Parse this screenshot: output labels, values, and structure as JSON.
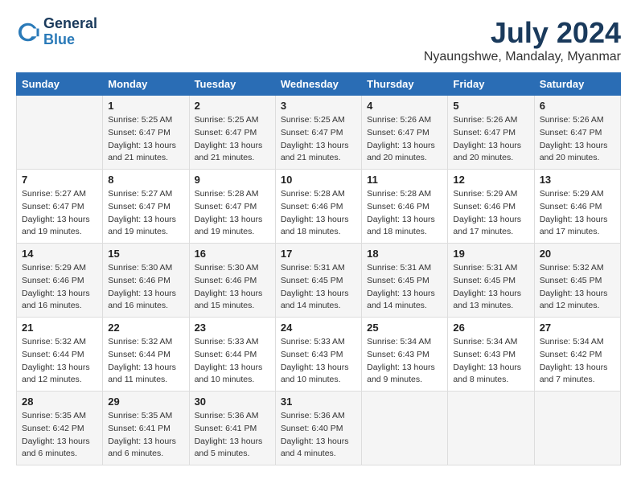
{
  "logo": {
    "line1": "General",
    "line2": "Blue"
  },
  "title": "July 2024",
  "subtitle": "Nyaungshwe, Mandalay, Myanmar",
  "headers": [
    "Sunday",
    "Monday",
    "Tuesday",
    "Wednesday",
    "Thursday",
    "Friday",
    "Saturday"
  ],
  "weeks": [
    [
      {
        "day": "",
        "info": ""
      },
      {
        "day": "1",
        "info": "Sunrise: 5:25 AM\nSunset: 6:47 PM\nDaylight: 13 hours\nand 21 minutes."
      },
      {
        "day": "2",
        "info": "Sunrise: 5:25 AM\nSunset: 6:47 PM\nDaylight: 13 hours\nand 21 minutes."
      },
      {
        "day": "3",
        "info": "Sunrise: 5:25 AM\nSunset: 6:47 PM\nDaylight: 13 hours\nand 21 minutes."
      },
      {
        "day": "4",
        "info": "Sunrise: 5:26 AM\nSunset: 6:47 PM\nDaylight: 13 hours\nand 20 minutes."
      },
      {
        "day": "5",
        "info": "Sunrise: 5:26 AM\nSunset: 6:47 PM\nDaylight: 13 hours\nand 20 minutes."
      },
      {
        "day": "6",
        "info": "Sunrise: 5:26 AM\nSunset: 6:47 PM\nDaylight: 13 hours\nand 20 minutes."
      }
    ],
    [
      {
        "day": "7",
        "info": "Sunrise: 5:27 AM\nSunset: 6:47 PM\nDaylight: 13 hours\nand 19 minutes."
      },
      {
        "day": "8",
        "info": "Sunrise: 5:27 AM\nSunset: 6:47 PM\nDaylight: 13 hours\nand 19 minutes."
      },
      {
        "day": "9",
        "info": "Sunrise: 5:28 AM\nSunset: 6:47 PM\nDaylight: 13 hours\nand 19 minutes."
      },
      {
        "day": "10",
        "info": "Sunrise: 5:28 AM\nSunset: 6:46 PM\nDaylight: 13 hours\nand 18 minutes."
      },
      {
        "day": "11",
        "info": "Sunrise: 5:28 AM\nSunset: 6:46 PM\nDaylight: 13 hours\nand 18 minutes."
      },
      {
        "day": "12",
        "info": "Sunrise: 5:29 AM\nSunset: 6:46 PM\nDaylight: 13 hours\nand 17 minutes."
      },
      {
        "day": "13",
        "info": "Sunrise: 5:29 AM\nSunset: 6:46 PM\nDaylight: 13 hours\nand 17 minutes."
      }
    ],
    [
      {
        "day": "14",
        "info": "Sunrise: 5:29 AM\nSunset: 6:46 PM\nDaylight: 13 hours\nand 16 minutes."
      },
      {
        "day": "15",
        "info": "Sunrise: 5:30 AM\nSunset: 6:46 PM\nDaylight: 13 hours\nand 16 minutes."
      },
      {
        "day": "16",
        "info": "Sunrise: 5:30 AM\nSunset: 6:46 PM\nDaylight: 13 hours\nand 15 minutes."
      },
      {
        "day": "17",
        "info": "Sunrise: 5:31 AM\nSunset: 6:45 PM\nDaylight: 13 hours\nand 14 minutes."
      },
      {
        "day": "18",
        "info": "Sunrise: 5:31 AM\nSunset: 6:45 PM\nDaylight: 13 hours\nand 14 minutes."
      },
      {
        "day": "19",
        "info": "Sunrise: 5:31 AM\nSunset: 6:45 PM\nDaylight: 13 hours\nand 13 minutes."
      },
      {
        "day": "20",
        "info": "Sunrise: 5:32 AM\nSunset: 6:45 PM\nDaylight: 13 hours\nand 12 minutes."
      }
    ],
    [
      {
        "day": "21",
        "info": "Sunrise: 5:32 AM\nSunset: 6:44 PM\nDaylight: 13 hours\nand 12 minutes."
      },
      {
        "day": "22",
        "info": "Sunrise: 5:32 AM\nSunset: 6:44 PM\nDaylight: 13 hours\nand 11 minutes."
      },
      {
        "day": "23",
        "info": "Sunrise: 5:33 AM\nSunset: 6:44 PM\nDaylight: 13 hours\nand 10 minutes."
      },
      {
        "day": "24",
        "info": "Sunrise: 5:33 AM\nSunset: 6:43 PM\nDaylight: 13 hours\nand 10 minutes."
      },
      {
        "day": "25",
        "info": "Sunrise: 5:34 AM\nSunset: 6:43 PM\nDaylight: 13 hours\nand 9 minutes."
      },
      {
        "day": "26",
        "info": "Sunrise: 5:34 AM\nSunset: 6:43 PM\nDaylight: 13 hours\nand 8 minutes."
      },
      {
        "day": "27",
        "info": "Sunrise: 5:34 AM\nSunset: 6:42 PM\nDaylight: 13 hours\nand 7 minutes."
      }
    ],
    [
      {
        "day": "28",
        "info": "Sunrise: 5:35 AM\nSunset: 6:42 PM\nDaylight: 13 hours\nand 6 minutes."
      },
      {
        "day": "29",
        "info": "Sunrise: 5:35 AM\nSunset: 6:41 PM\nDaylight: 13 hours\nand 6 minutes."
      },
      {
        "day": "30",
        "info": "Sunrise: 5:36 AM\nSunset: 6:41 PM\nDaylight: 13 hours\nand 5 minutes."
      },
      {
        "day": "31",
        "info": "Sunrise: 5:36 AM\nSunset: 6:40 PM\nDaylight: 13 hours\nand 4 minutes."
      },
      {
        "day": "",
        "info": ""
      },
      {
        "day": "",
        "info": ""
      },
      {
        "day": "",
        "info": ""
      }
    ]
  ]
}
